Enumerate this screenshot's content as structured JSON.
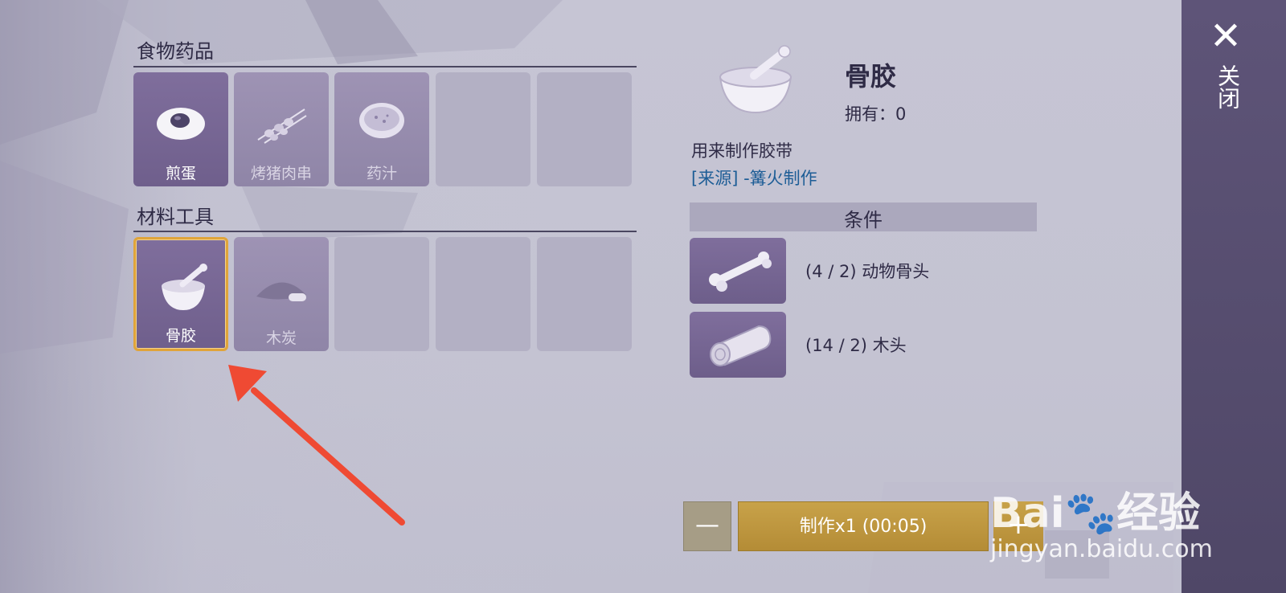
{
  "sections": {
    "food": {
      "title": "食物药品",
      "items": [
        "煎蛋",
        "烤猪肉串",
        "药汁"
      ]
    },
    "material": {
      "title": "材料工具",
      "items": [
        "骨胶",
        "木炭"
      ]
    }
  },
  "detail": {
    "name": "骨胶",
    "owned": "拥有：0",
    "description": "用来制作胶带",
    "source_tag": "[来源]",
    "source_text": " -篝火制作",
    "conditions_title": "条件",
    "requirements": [
      {
        "text": "(4 / 2) 动物骨头",
        "icon": "bone-icon"
      },
      {
        "text": "(14 / 2) 木头",
        "icon": "log-icon"
      }
    ]
  },
  "craft": {
    "minus": "—",
    "button": "制作x1 (00:05)",
    "plus": "+"
  },
  "sidebar": {
    "close_icon": "✕",
    "close_label": "关闭"
  },
  "watermark": {
    "line1": "Bai🐾经验",
    "line2": "jingyan.baidu.com"
  },
  "colors": {
    "accent_gold": "#c8a249",
    "selected_border": "#e0a43a",
    "slot_purple": "#7f6e9c",
    "annotation_arrow": "#ef4a33"
  }
}
